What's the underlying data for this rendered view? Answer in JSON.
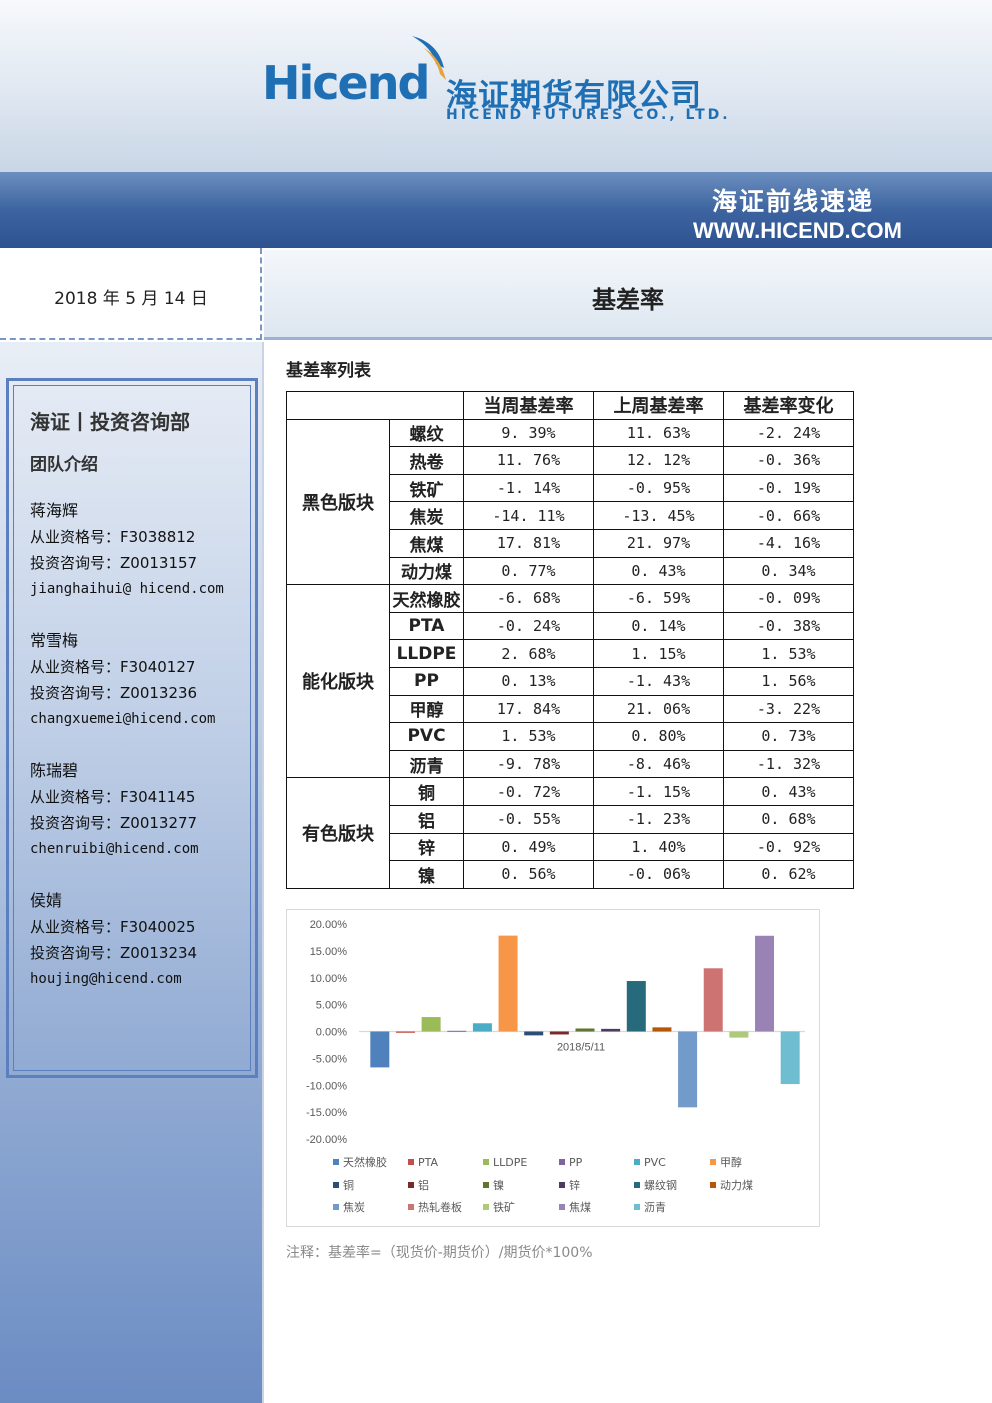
{
  "header": {
    "logo_latin": "Hicend",
    "logo_cn": "海证期货有限公司",
    "logo_en": "HICEND  FUTURES  CO.,  LTD.",
    "bar_cn": "海证前线速递",
    "bar_url": "WWW.HICEND.COM"
  },
  "date": "2018 年 5 月 14 日",
  "page_title": "基差率",
  "sidebar": {
    "dept": "海证丨投资咨询部",
    "team": "团队介绍",
    "members": [
      {
        "name": "蒋海辉",
        "qual": "从业资格号：F3038812",
        "invest": "投资咨询号：Z0013157",
        "email": "jianghaihui@ hicend.com"
      },
      {
        "name": "常雪梅",
        "qual": "从业资格号：F3040127",
        "invest": "投资咨询号：Z0013236",
        "email": "changxuemei@hicend.com"
      },
      {
        "name": "陈瑞碧",
        "qual": "从业资格号：F3041145",
        "invest": "投资咨询号：Z0013277",
        "email": "chenruibi@hicend.com"
      },
      {
        "name": "侯婧",
        "qual": "从业资格号：F3040025",
        "invest": "投资咨询号：Z0013234",
        "email": "houjing@hicend.com"
      }
    ]
  },
  "table": {
    "section_title": "基差率列表",
    "headers": [
      "当周基差率",
      "上周基差率",
      "基差率变化"
    ],
    "groups": [
      {
        "sector": "黑色版块",
        "rows": [
          {
            "name": "螺纹",
            "cur": "9. 39%",
            "prev": "11. 63%",
            "chg": "-2. 24%"
          },
          {
            "name": "热卷",
            "cur": "11. 76%",
            "prev": "12. 12%",
            "chg": "-0. 36%"
          },
          {
            "name": "铁矿",
            "cur": "-1. 14%",
            "prev": "-0. 95%",
            "chg": "-0. 19%"
          },
          {
            "name": "焦炭",
            "cur": "-14. 11%",
            "prev": "-13. 45%",
            "chg": "-0. 66%"
          },
          {
            "name": "焦煤",
            "cur": "17. 81%",
            "prev": "21. 97%",
            "chg": "-4. 16%"
          },
          {
            "name": "动力煤",
            "cur": "0. 77%",
            "prev": "0. 43%",
            "chg": "0. 34%"
          }
        ]
      },
      {
        "sector": "能化版块",
        "rows": [
          {
            "name": "天然橡胶",
            "cur": "-6. 68%",
            "prev": "-6. 59%",
            "chg": "-0. 09%"
          },
          {
            "name": "PTA",
            "cur": "-0. 24%",
            "prev": "0. 14%",
            "chg": "-0. 38%"
          },
          {
            "name": "LLDPE",
            "cur": "2. 68%",
            "prev": "1. 15%",
            "chg": "1. 53%"
          },
          {
            "name": "PP",
            "cur": "0. 13%",
            "prev": "-1. 43%",
            "chg": "1. 56%"
          },
          {
            "name": "甲醇",
            "cur": "17. 84%",
            "prev": "21. 06%",
            "chg": "-3. 22%"
          },
          {
            "name": "PVC",
            "cur": "1. 53%",
            "prev": "0. 80%",
            "chg": "0. 73%"
          },
          {
            "name": "沥青",
            "cur": "-9. 78%",
            "prev": "-8. 46%",
            "chg": "-1. 32%"
          }
        ]
      },
      {
        "sector": "有色版块",
        "rows": [
          {
            "name": "铜",
            "cur": "-0. 72%",
            "prev": "-1. 15%",
            "chg": "0. 43%"
          },
          {
            "name": "铝",
            "cur": "-0. 55%",
            "prev": "-1. 23%",
            "chg": "0. 68%"
          },
          {
            "name": "锌",
            "cur": "0. 49%",
            "prev": "1. 40%",
            "chg": "-0. 92%"
          },
          {
            "name": "镍",
            "cur": "0. 56%",
            "prev": "-0. 06%",
            "chg": "0. 62%"
          }
        ]
      }
    ]
  },
  "chart_data": {
    "type": "bar",
    "categories": [
      "2018/5/11"
    ],
    "ylim": [
      -20,
      20
    ],
    "yticks": [
      "20.00%",
      "15.00%",
      "10.00%",
      "5.00%",
      "0.00%",
      "-5.00%",
      "-10.00%",
      "-15.00%",
      "-20.00%"
    ],
    "series": [
      {
        "name": "天然橡胶",
        "color": "#4f81bd",
        "values": [
          -6.68
        ]
      },
      {
        "name": "PTA",
        "color": "#c0504d",
        "values": [
          -0.24
        ]
      },
      {
        "name": "LLDPE",
        "color": "#9bbb59",
        "values": [
          2.68
        ]
      },
      {
        "name": "PP",
        "color": "#8064a2",
        "values": [
          0.13
        ]
      },
      {
        "name": "PVC",
        "color": "#4bacc6",
        "values": [
          1.53
        ]
      },
      {
        "name": "甲醇",
        "color": "#f79646",
        "values": [
          17.84
        ]
      },
      {
        "name": "铜",
        "color": "#2c4d75",
        "values": [
          -0.72
        ]
      },
      {
        "name": "铝",
        "color": "#772c2a",
        "values": [
          -0.55
        ]
      },
      {
        "name": "镍",
        "color": "#5f7530",
        "values": [
          0.56
        ]
      },
      {
        "name": "锌",
        "color": "#4d3b62",
        "values": [
          0.49
        ]
      },
      {
        "name": "螺纹钢",
        "color": "#276a7c",
        "values": [
          9.39
        ]
      },
      {
        "name": "动力煤",
        "color": "#b65708",
        "values": [
          0.77
        ]
      },
      {
        "name": "焦炭",
        "color": "#729aca",
        "values": [
          -14.11
        ]
      },
      {
        "name": "热轧卷板",
        "color": "#cd7371",
        "values": [
          11.76
        ]
      },
      {
        "name": "铁矿",
        "color": "#afc97a",
        "values": [
          -1.14
        ]
      },
      {
        "name": "焦煤",
        "color": "#9983b5",
        "values": [
          17.81
        ]
      },
      {
        "name": "沥青",
        "color": "#6fbdd1",
        "values": [
          -9.78
        ]
      }
    ]
  },
  "note": "注释：基差率=（现货价-期货价）/期货价*100%"
}
